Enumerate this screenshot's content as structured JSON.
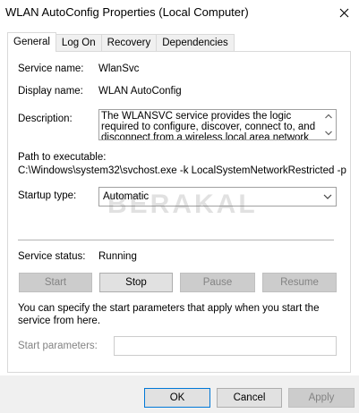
{
  "window": {
    "title": "WLAN AutoConfig Properties (Local Computer)",
    "close_glyph": "✕"
  },
  "tabs": [
    {
      "label": "General",
      "active": true
    },
    {
      "label": "Log On",
      "active": false
    },
    {
      "label": "Recovery",
      "active": false
    },
    {
      "label": "Dependencies",
      "active": false
    }
  ],
  "general": {
    "service_name_label": "Service name:",
    "service_name": "WlanSvc",
    "display_name_label": "Display name:",
    "display_name": "WLAN AutoConfig",
    "description_label": "Description:",
    "description": "The WLANSVC service provides the logic required to configure, discover, connect to, and disconnect from a wireless local area network (WLAN) as",
    "path_label": "Path to executable:",
    "path": "C:\\Windows\\system32\\svchost.exe -k LocalSystemNetworkRestricted -p",
    "startup_type_label": "Startup type:",
    "startup_type": "Automatic",
    "service_status_label": "Service status:",
    "service_status": "Running",
    "buttons": {
      "start": "Start",
      "stop": "Stop",
      "pause": "Pause",
      "resume": "Resume"
    },
    "hint": "You can specify the start parameters that apply when you start the service from here.",
    "start_params_label": "Start parameters:",
    "start_params_value": ""
  },
  "footer": {
    "ok": "OK",
    "cancel": "Cancel",
    "apply": "Apply"
  },
  "watermark": "BERAKAL",
  "colors": {
    "focus_border": "#0078d7",
    "disabled_text": "#838383"
  }
}
